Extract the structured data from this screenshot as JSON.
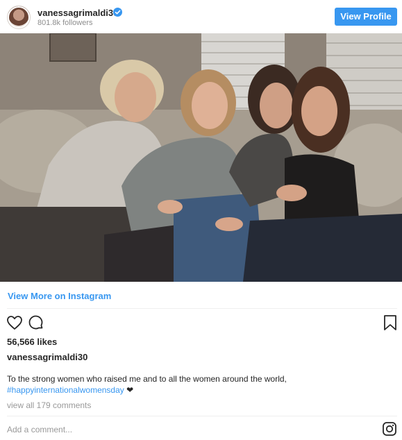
{
  "header": {
    "username": "vanessagrimaldi30",
    "followers": "801.8k followers",
    "view_profile_label": "View Profile"
  },
  "post": {
    "view_more_label": "View More on Instagram",
    "likes": "56,566 likes",
    "caption_user": "vanessagrimaldi30",
    "caption_text": "To the strong women who raised me and to all the women around the world,",
    "hashtag": "#happyinternationalwomensday",
    "caption_end": "❤",
    "view_comments": "view all 179 comments"
  },
  "comment": {
    "placeholder": "Add a comment..."
  },
  "colors": {
    "accent": "#3897f0",
    "text": "#262626",
    "muted": "#999999"
  },
  "icons": {
    "like": "heart-icon",
    "comment": "comment-icon",
    "save": "bookmark-icon",
    "brand": "instagram-icon",
    "verified": "verified-badge-icon"
  }
}
